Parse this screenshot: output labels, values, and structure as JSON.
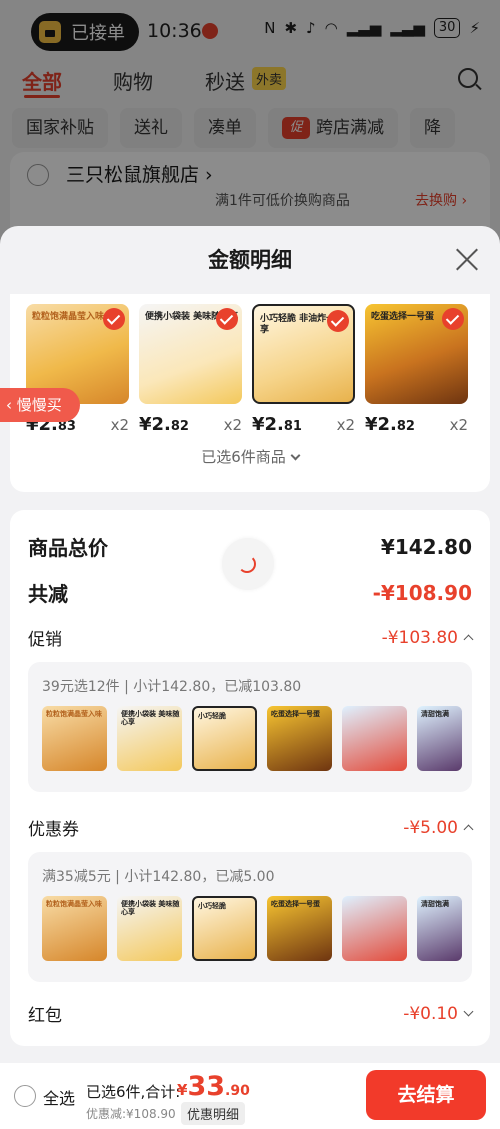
{
  "status_bar": {
    "pill_label": "已接单",
    "time": "10:36",
    "icons": [
      "nfc-icon",
      "bluetooth-icon",
      "mute-icon",
      "wifi-icon",
      "signal-icon",
      "signal-icon"
    ],
    "battery": "30"
  },
  "top_nav": {
    "tabs": [
      {
        "label": "全部",
        "active": true
      },
      {
        "label": "购物",
        "active": false
      },
      {
        "label": "秒送",
        "active": false
      }
    ],
    "waimai_tag": "外卖"
  },
  "chips": [
    "国家补贴",
    "送礼",
    "凑单",
    "跨店满减",
    "降"
  ],
  "chip_cu": "促",
  "shop": {
    "name": "三只松鼠旗舰店",
    "hint": "满1件可低价换购商品",
    "swap": "去换购"
  },
  "sheet": {
    "title": "金额明细",
    "products": [
      {
        "label": "粒粒饱满晶莹入味",
        "yuan": "¥2.",
        "cents": "83",
        "qty": "x2"
      },
      {
        "label": "便携小袋装 美味随心享",
        "yuan": "¥2.",
        "cents": "82",
        "qty": "x2"
      },
      {
        "label": "小巧轻脆 非油炸一口享",
        "yuan": "¥2.",
        "cents": "81",
        "qty": "x2"
      },
      {
        "label": "吃蛋选择一号蛋",
        "yuan": "¥2.",
        "cents": "82",
        "qty": "x2"
      }
    ],
    "selected_count": "已选6件商品",
    "slow_buy": "慢慢买",
    "total_label": "商品总价",
    "total_value": "¥142.80",
    "reduce_label": "共减",
    "reduce_value": "-¥108.90",
    "promo_label": "促销",
    "promo_value": "-¥103.80",
    "promo_group_title": "39元选12件 | 小计142.80，已减103.80",
    "coupon_label": "优惠券",
    "coupon_value": "-¥5.00",
    "coupon_group_title": "满35减5元 | 小计142.80，已减5.00",
    "redpack_label": "红包",
    "redpack_value": "-¥0.10",
    "thumb_labels": [
      "粒粒饱满晶莹入味",
      "便携小袋装 美味随心享",
      "小巧轻脆",
      "吃蛋选择一号蛋",
      "",
      "清甜饱满"
    ]
  },
  "bottom_bar": {
    "select_all": "全选",
    "summary": "已选6件,合计:",
    "currency": "¥",
    "amount_int": "33",
    "amount_dec": ".90",
    "reduced": "优惠减:¥108.90",
    "detail_button": "优惠明细",
    "checkout": "去结算"
  },
  "colors": {
    "accent": "#e8412c",
    "checkout": "#f23a2a"
  }
}
